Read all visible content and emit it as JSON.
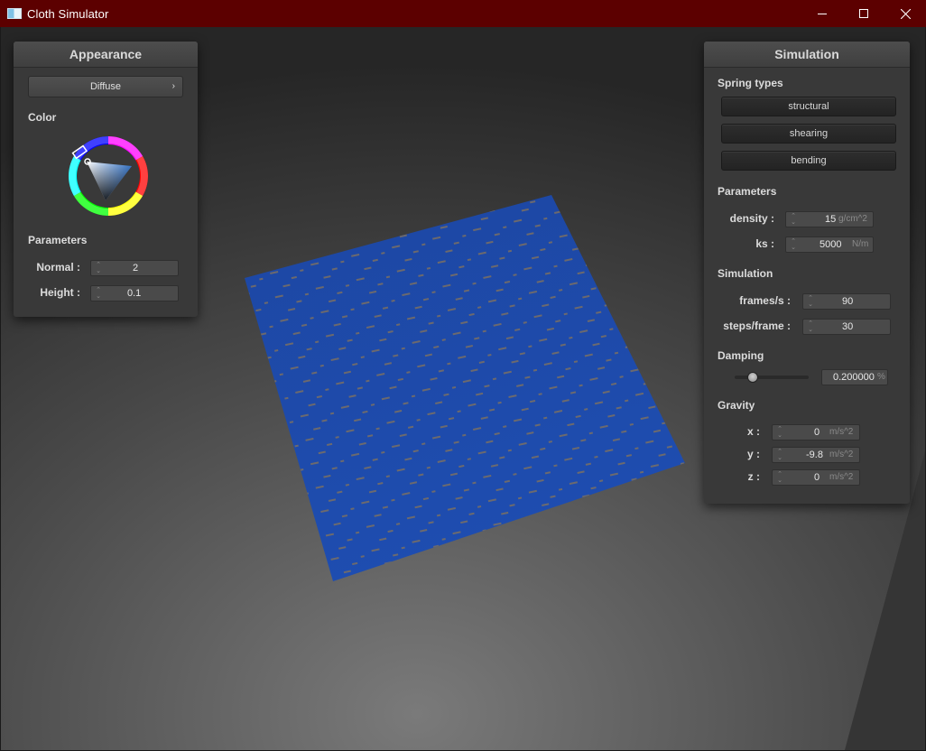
{
  "window": {
    "title": "Cloth Simulator",
    "icon": "window-app-icon",
    "controls": {
      "minimize": "minimize-icon",
      "maximize": "maximize-icon",
      "close": "close-icon"
    },
    "titlebar_color": "#5c0000"
  },
  "scene": {
    "cloth_color": "#1e4aa6",
    "background_color": "#2a2a2a"
  },
  "appearance": {
    "title": "Appearance",
    "shader_select": "Diffuse",
    "color_label": "Color",
    "color_picker_icon": "color-wheel-icon",
    "selected_hue_color": "#4a90e2",
    "parameters_label": "Parameters",
    "normal": {
      "label": "Normal :",
      "value": "2"
    },
    "height": {
      "label": "Height :",
      "value": "0.1"
    }
  },
  "simulation": {
    "title": "Simulation",
    "spring_types_label": "Spring types",
    "spring_buttons": [
      "structural",
      "shearing",
      "bending"
    ],
    "parameters_label": "Parameters",
    "density": {
      "label": "density :",
      "value": "15",
      "unit": "g/cm^2"
    },
    "ks": {
      "label": "ks :",
      "value": "5000",
      "unit": "N/m"
    },
    "simulation_label": "Simulation",
    "frames_per_sec": {
      "label": "frames/s :",
      "value": "90"
    },
    "steps_per_frame": {
      "label": "steps/frame :",
      "value": "30"
    },
    "damping_label": "Damping",
    "damping": {
      "value": "0.200000",
      "unit": "%",
      "slider_fraction": 0.2
    },
    "gravity_label": "Gravity",
    "gravity": {
      "x": {
        "label": "x :",
        "value": "0",
        "unit": "m/s^2"
      },
      "y": {
        "label": "y :",
        "value": "-9.8",
        "unit": "m/s^2"
      },
      "z": {
        "label": "z :",
        "value": "0",
        "unit": "m/s^2"
      }
    }
  }
}
